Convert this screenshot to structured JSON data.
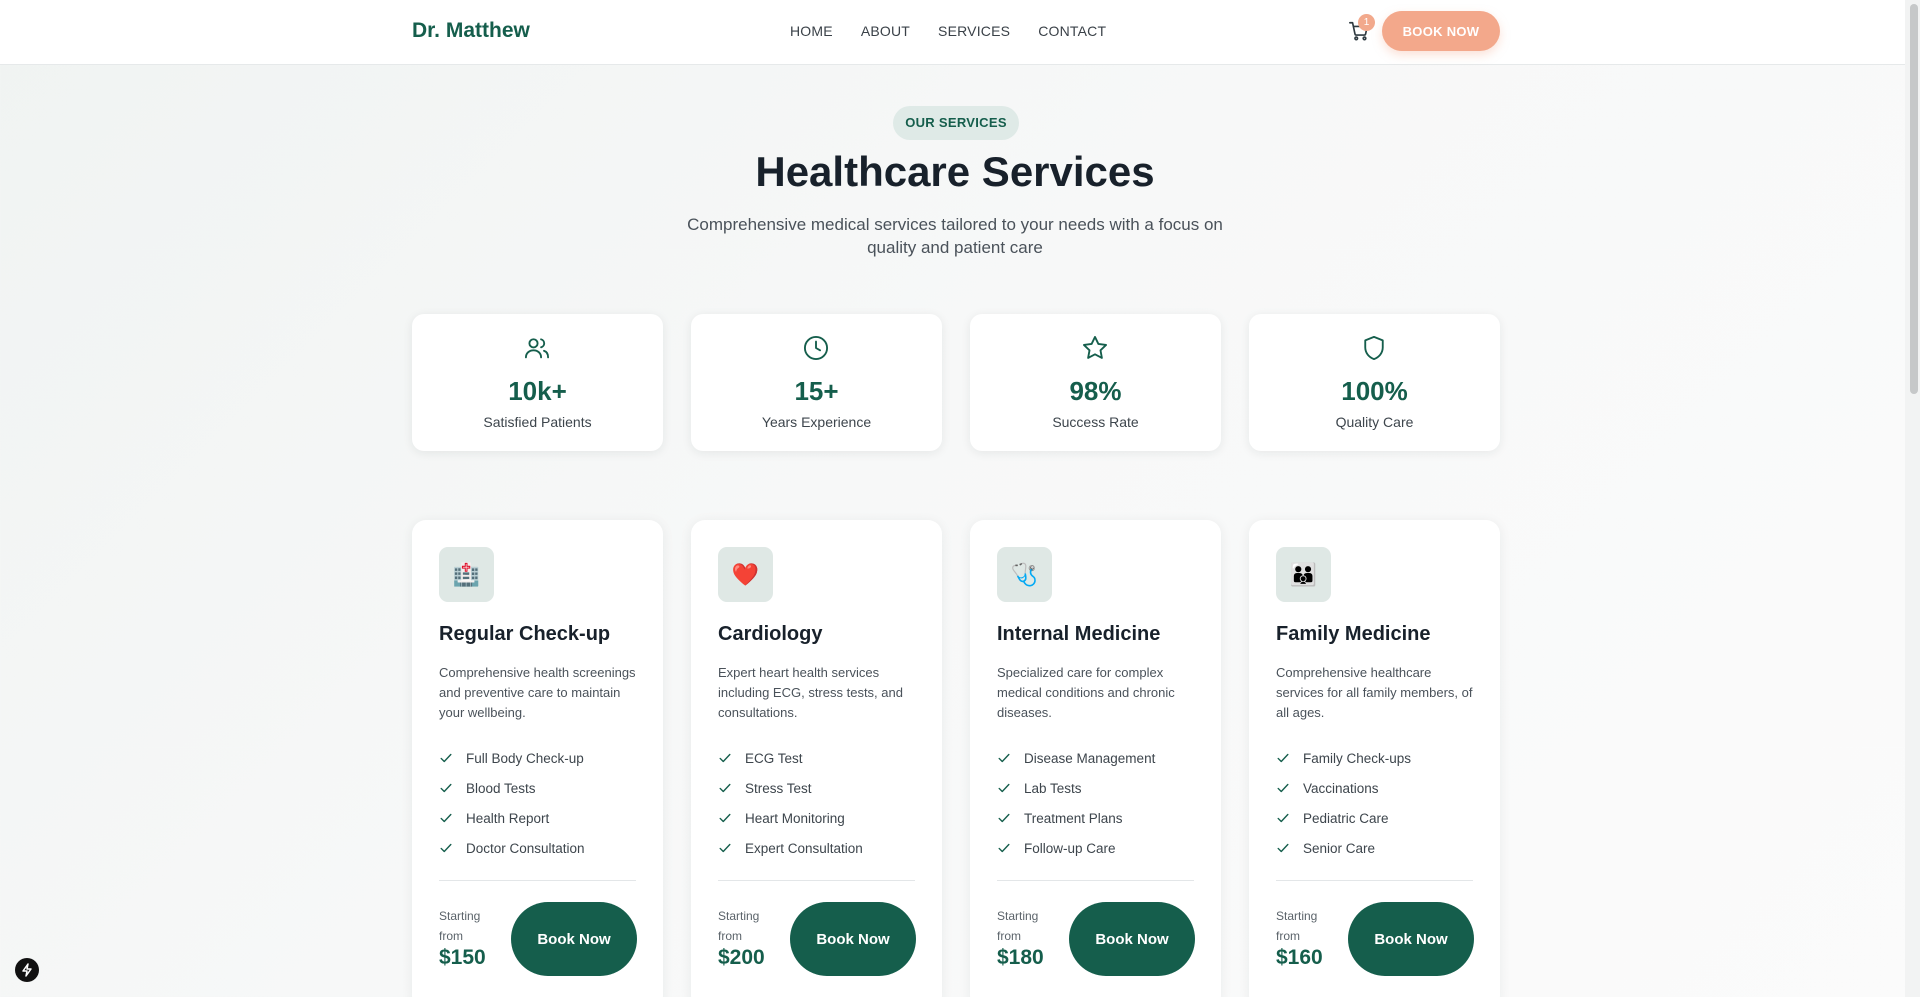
{
  "header": {
    "brand": "Dr. Matthew",
    "nav": [
      "HOME",
      "ABOUT",
      "SERVICES",
      "CONTACT"
    ],
    "cart_count": "1",
    "cta_label": "BOOK NOW"
  },
  "hero": {
    "eyebrow": "OUR SERVICES",
    "title": "Healthcare Services",
    "subtitle": "Comprehensive medical services tailored to your needs with a focus on quality and patient care"
  },
  "stats": [
    {
      "icon": "users-icon",
      "value": "10k+",
      "label": "Satisfied Patients"
    },
    {
      "icon": "clock-icon",
      "value": "15+",
      "label": "Years Experience"
    },
    {
      "icon": "star-icon",
      "value": "98%",
      "label": "Success Rate"
    },
    {
      "icon": "shield-icon",
      "value": "100%",
      "label": "Quality Care"
    }
  ],
  "services": [
    {
      "icon": "hospital-icon",
      "emoji": "🏥",
      "title": "Regular Check-up",
      "description": "Comprehensive health screenings and preventive care to maintain your wellbeing.",
      "features": [
        "Full Body Check-up",
        "Blood Tests",
        "Health Report",
        "Doctor Consultation"
      ],
      "starting_label": "Starting from",
      "price": "$150",
      "button_label": "Book Now"
    },
    {
      "icon": "heart-icon",
      "emoji": "❤️",
      "title": "Cardiology",
      "description": "Expert heart health services including ECG, stress tests, and consultations.",
      "features": [
        "ECG Test",
        "Stress Test",
        "Heart Monitoring",
        "Expert Consultation"
      ],
      "starting_label": "Starting from",
      "price": "$200",
      "button_label": "Book Now"
    },
    {
      "icon": "stethoscope-icon",
      "emoji": "🩺",
      "title": "Internal Medicine",
      "description": "Specialized care for complex medical conditions and chronic diseases.",
      "features": [
        "Disease Management",
        "Lab Tests",
        "Treatment Plans",
        "Follow-up Care"
      ],
      "starting_label": "Starting from",
      "price": "$180",
      "button_label": "Book Now"
    },
    {
      "icon": "family-icon",
      "emoji": "👪",
      "title": "Family Medicine",
      "description": "Comprehensive healthcare services for all family members, of all ages.",
      "features": [
        "Family Check-ups",
        "Vaccinations",
        "Pediatric Care",
        "Senior Care"
      ],
      "starting_label": "Starting from",
      "price": "$160",
      "button_label": "Book Now"
    }
  ],
  "colors": {
    "brand": "#155e4c",
    "accent": "#f3a88b",
    "pill_bg": "#dfeae7"
  }
}
